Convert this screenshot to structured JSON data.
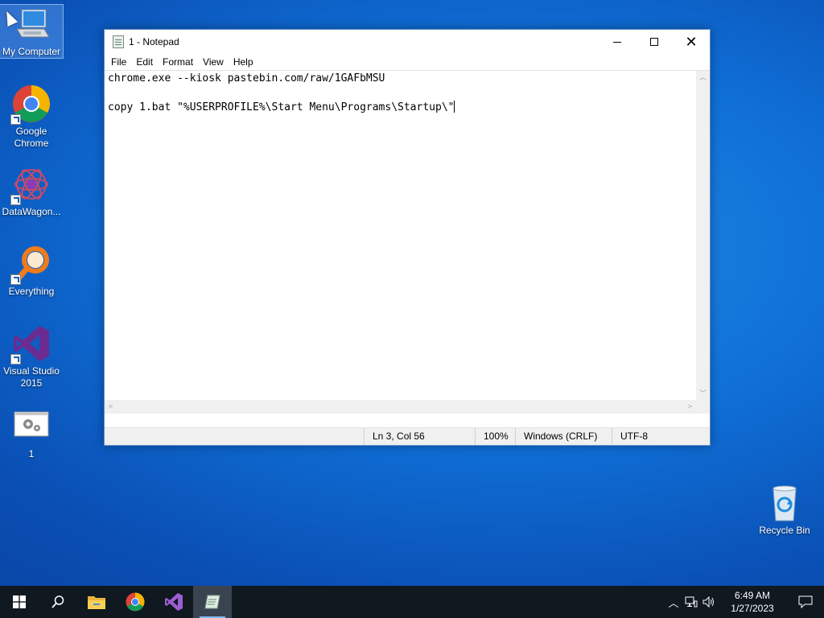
{
  "desktop": {
    "icons": [
      {
        "label": "My Computer"
      },
      {
        "label": "Google Chrome"
      },
      {
        "label": "DataWagon..."
      },
      {
        "label": "Everything"
      },
      {
        "label": "Visual Studio 2015"
      },
      {
        "label": "1"
      },
      {
        "label": "Recycle Bin"
      }
    ]
  },
  "notepad": {
    "title": "1 - Notepad",
    "menu": [
      "File",
      "Edit",
      "Format",
      "View",
      "Help"
    ],
    "lines": [
      "chrome.exe --kiosk pastebin.com/raw/1GAFbMSU",
      "",
      "copy 1.bat \"%USERPROFILE%\\Start Menu\\Programs\\Startup\\\""
    ],
    "status": {
      "position": "Ln 3, Col 56",
      "zoom": "100%",
      "line_ending": "Windows (CRLF)",
      "encoding": "UTF-8"
    }
  },
  "taskbar": {
    "pinned": [
      "windows-start",
      "search",
      "file-explorer",
      "chrome",
      "visual-studio",
      "notepad"
    ],
    "clock": {
      "time": "6:49 AM",
      "date": "1/27/2023"
    }
  },
  "colors": {
    "accent": "#0f6fd6",
    "taskbar": "#101820"
  }
}
